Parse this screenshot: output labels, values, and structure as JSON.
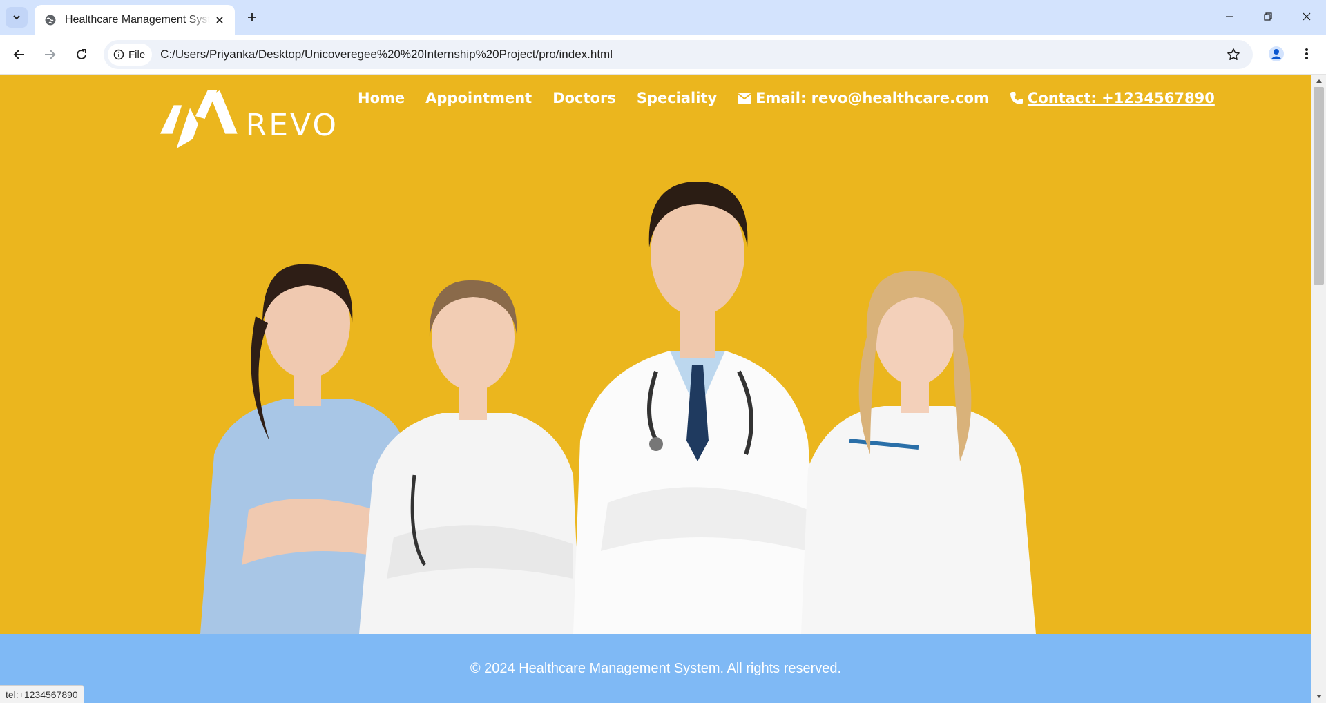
{
  "browser": {
    "tab_title": "Healthcare Management System",
    "address_chip": "File",
    "url": "C:/Users/Priyanka/Desktop/Unicoveregee%20%20Internship%20Project/pro/index.html",
    "status_url": "tel:+1234567890"
  },
  "site": {
    "logo_text": "REVO",
    "nav": {
      "home": "Home",
      "appointment": "Appointment",
      "doctors": "Doctors",
      "speciality": "Speciality",
      "email": "Email: revo@healthcare.com",
      "contact": "Contact: +1234567890"
    },
    "footer": "© 2024 Healthcare Management System. All rights reserved."
  },
  "colors": {
    "hero_background": "#ebb61e",
    "footer_background": "#7fb9f5",
    "browser_tabstrip": "#d3e3fd"
  },
  "icons": {
    "tab_favicon": "globe-icon",
    "email": "envelope-icon",
    "contact": "phone-icon"
  }
}
